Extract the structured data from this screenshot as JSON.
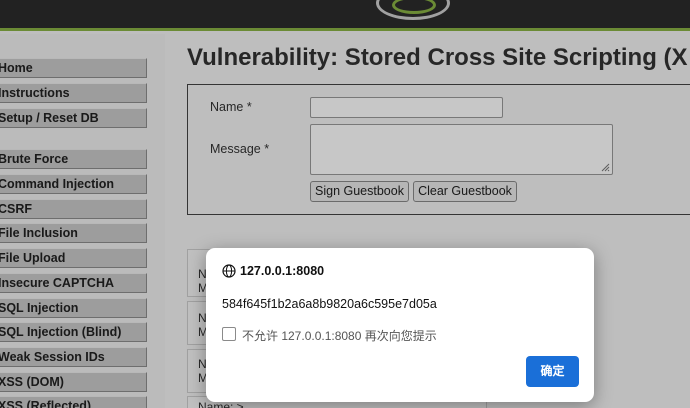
{
  "page": {
    "title": "Vulnerability: Stored Cross Site Scripting (X"
  },
  "sidebar": {
    "items": [
      {
        "label": "Home"
      },
      {
        "label": "Instructions"
      },
      {
        "label": "Setup / Reset DB"
      },
      {
        "label": "Brute Force"
      },
      {
        "label": "Command Injection"
      },
      {
        "label": "CSRF"
      },
      {
        "label": "File Inclusion"
      },
      {
        "label": "File Upload"
      },
      {
        "label": "Insecure CAPTCHA"
      },
      {
        "label": "SQL Injection"
      },
      {
        "label": "SQL Injection (Blind)"
      },
      {
        "label": "Weak Session IDs"
      },
      {
        "label": "XSS (DOM)"
      },
      {
        "label": "XSS (Reflected)"
      }
    ]
  },
  "form": {
    "name_label": "Name *",
    "message_label": "Message *",
    "name_value": "",
    "message_value": "",
    "sign_button": "Sign Guestbook",
    "clear_button": "Clear Guestbook"
  },
  "entries": {
    "e1_a": "N",
    "e1_b": "M",
    "e2_a": "N",
    "e2_b": "M",
    "e3_a": "N",
    "e3_b": "M",
    "e4_a": "Name: >"
  },
  "dialog": {
    "origin": "127.0.0.1:8080",
    "message": "584f645f1b2a6a8b9820a6c595e7d05a",
    "checkbox_label": "不允许 127.0.0.1:8080 再次向您提示",
    "ok_button": "确定"
  },
  "colors": {
    "accent_green": "#8ab344",
    "ok_blue": "#1a6fd8"
  }
}
